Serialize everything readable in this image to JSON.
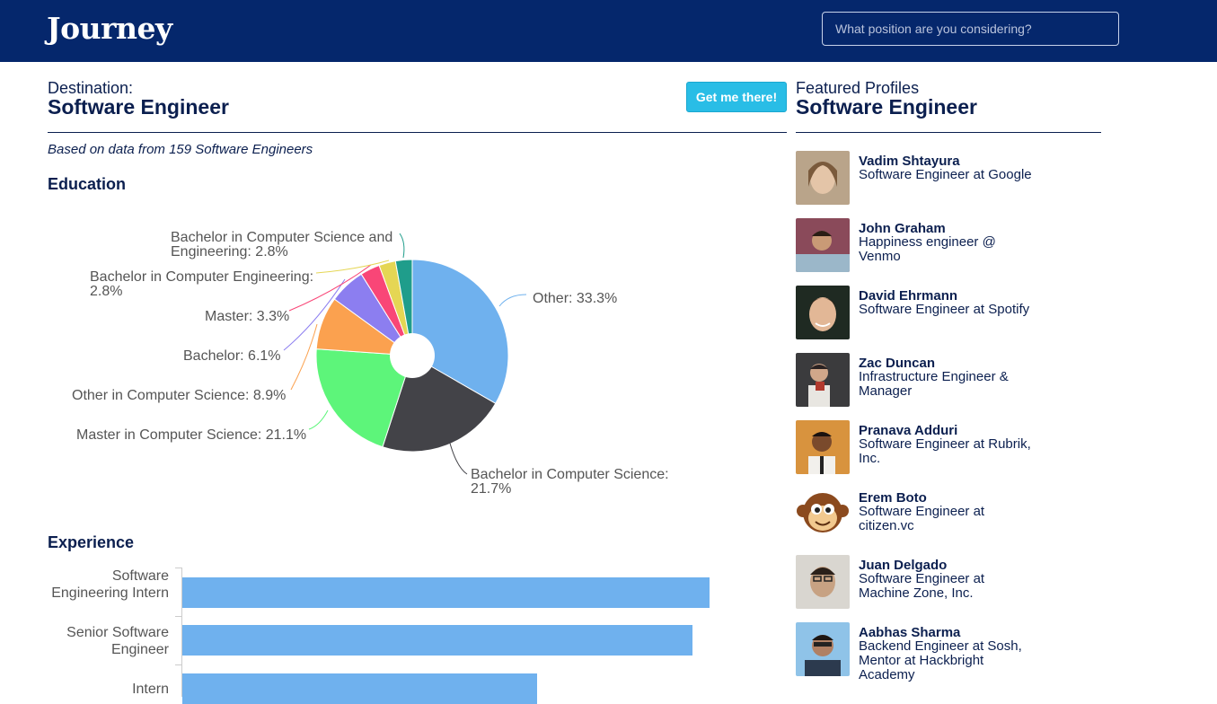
{
  "header": {
    "brand": "Journey",
    "search_placeholder": "What position are you considering?"
  },
  "destination": {
    "label": "Destination:",
    "title": "Software Engineer",
    "cta_label": "Get me there!",
    "based_on": "Based on data from 159 Software Engineers"
  },
  "education": {
    "heading": "Education"
  },
  "experience": {
    "heading": "Experience"
  },
  "featured": {
    "label": "Featured Profiles",
    "title": "Software Engineer",
    "profiles": [
      {
        "name": "Vadim Shtayura",
        "role": "Software Engineer at Google"
      },
      {
        "name": "John Graham",
        "role": "Happiness engineer @ Venmo"
      },
      {
        "name": "David Ehrmann",
        "role": "Software Engineer at Spotify"
      },
      {
        "name": "Zac Duncan",
        "role": "Infrastructure Engineer & Manager"
      },
      {
        "name": "Pranava Adduri",
        "role": "Software Engineer at Rubrik, Inc."
      },
      {
        "name": "Erem Boto",
        "role": "Software Engineer at citizen.vc"
      },
      {
        "name": "Juan Delgado",
        "role": "Software Engineer at Machine Zone, Inc."
      },
      {
        "name": "Aabhas Sharma",
        "role": "Backend Engineer at Sosh, Mentor at Hackbright Academy"
      }
    ]
  },
  "chart_data": [
    {
      "type": "pie",
      "donut": true,
      "slices": [
        {
          "label": "Other: 33.3%",
          "category": "Other",
          "value": 33.3,
          "color": "#6fb1ee"
        },
        {
          "label": "Bachelor in Computer Science: 21.7%",
          "category": "Bachelor in Computer Science",
          "value": 21.7,
          "color": "#434348"
        },
        {
          "label": "Master in Computer Science: 21.1%",
          "category": "Master in Computer Science",
          "value": 21.1,
          "color": "#5df57a"
        },
        {
          "label": "Other in Computer Science: 8.9%",
          "category": "Other in Computer Science",
          "value": 8.9,
          "color": "#fba14f"
        },
        {
          "label": "Bachelor: 6.1%",
          "category": "Bachelor",
          "value": 6.1,
          "color": "#8c7ef0"
        },
        {
          "label": "Master: 3.3%",
          "category": "Master",
          "value": 3.3,
          "color": "#f94677"
        },
        {
          "label": "Bachelor in Computer Engineering: 2.8%",
          "category": "Bachelor in Computer Engineering",
          "value": 2.8,
          "color": "#e5d654"
        },
        {
          "label": "Bachelor in Computer Science and Engineering: 2.8%",
          "category": "Bachelor in Computer Science and Engineering",
          "value": 2.8,
          "color": "#1f9d8b"
        }
      ]
    },
    {
      "type": "bar",
      "orientation": "horizontal",
      "categories": [
        "Software Engineering Intern",
        "Senior Software Engineer",
        "Intern"
      ],
      "values": [
        100,
        96.7,
        67.3
      ],
      "color": "#6fb1ee"
    }
  ]
}
